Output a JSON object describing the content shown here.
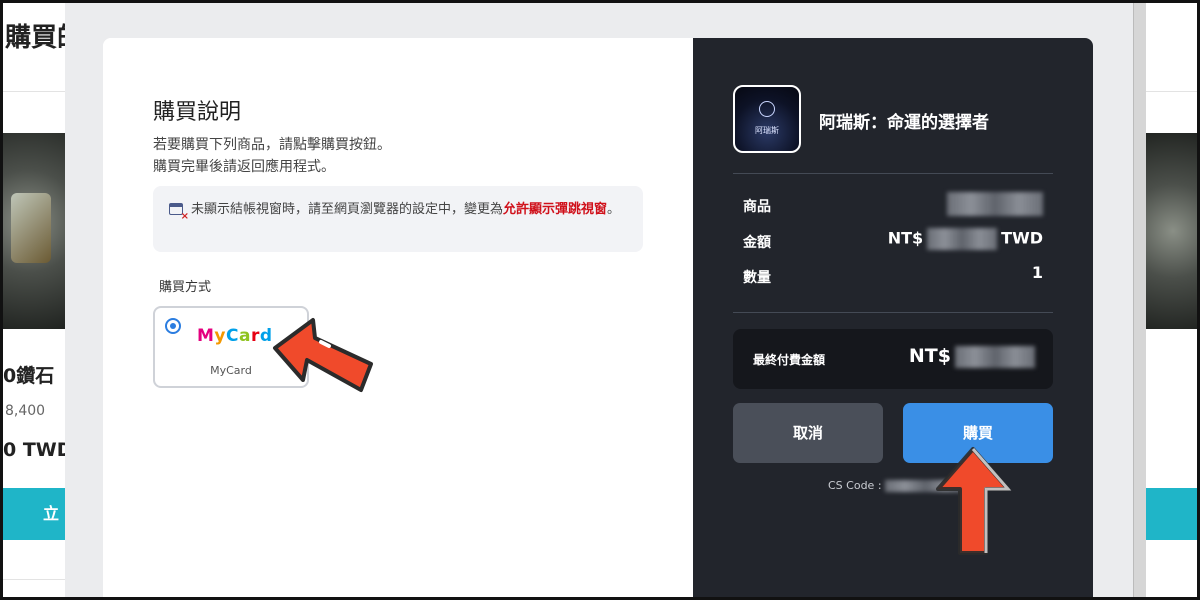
{
  "background_page": {
    "title": "購買的",
    "item_name": "0鑽石",
    "item_original_price": "8,400",
    "item_price": "0 TWD",
    "buy_button_label": "立"
  },
  "instructions": {
    "title": "購買說明",
    "line1": "若要購買下列商品，請點擊購買按鈕。",
    "line2": "購買完畢後請返回應用程式。",
    "notice_text": "未顯示結帳視窗時，請至網頁瀏覽器的設定中，變更為",
    "notice_highlight": "允許顯示彈跳視窗",
    "notice_end": "。"
  },
  "payment_method": {
    "label": "購買方式",
    "option_label": "MyCard",
    "logo_letters": [
      "M",
      "y",
      "C",
      "a",
      "r",
      "d"
    ]
  },
  "summary": {
    "game_name": "阿瑞斯：命運的選擇者",
    "game_icon_text": "阿瑞斯",
    "product_label": "商品",
    "amount_label": "金額",
    "amount_prefix": "NT$",
    "amount_suffix": "TWD",
    "quantity_label": "數量",
    "quantity_value": "1",
    "final_label": "最終付費金額",
    "final_prefix": "NT$",
    "cancel_label": "取消",
    "buy_label": "購買",
    "cs_code_label": "CS Code :"
  },
  "colors": {
    "accent_blue": "#3a8fe6",
    "panel_dark": "#22252c",
    "warning_red": "#d0111b",
    "arrow_red": "#f04a2b"
  },
  "icons": [
    "popup-blocked-icon",
    "radio-selected-icon",
    "mycard-logo",
    "game-icon",
    "red-arrow-annotation"
  ]
}
